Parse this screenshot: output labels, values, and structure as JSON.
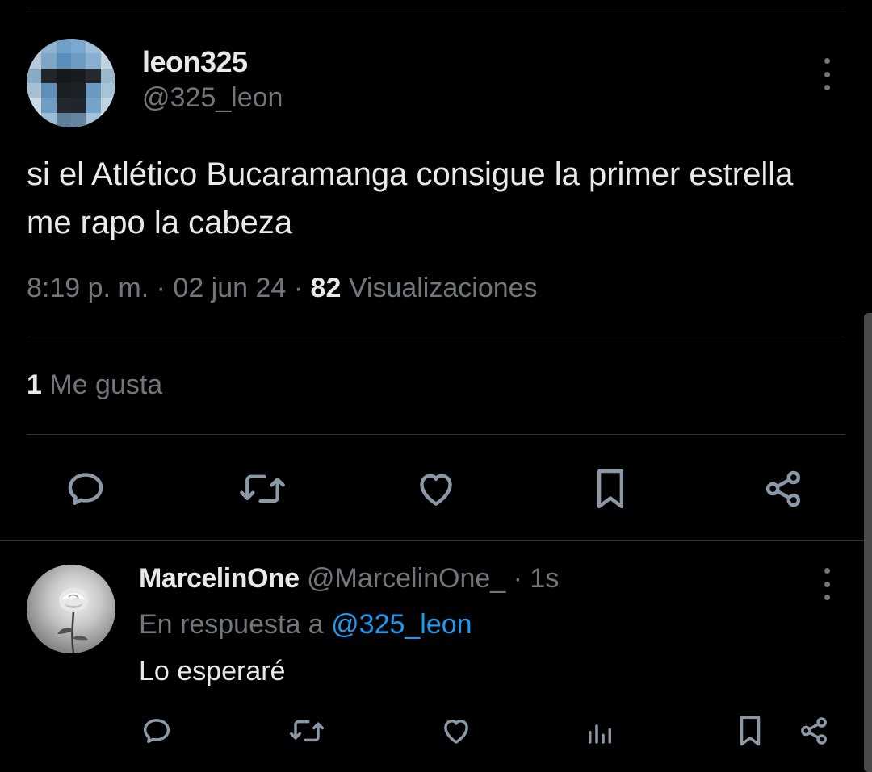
{
  "tweet": {
    "display_name": "leon325",
    "handle": "@325_leon",
    "text": "si el Atlético Bucaramanga consigue la primer estrella me rapo la cabeza",
    "time": "8:19 p. m.",
    "date": "02 jun 24",
    "separator": " · ",
    "views_count": "82",
    "views_label": " Visualizaciones",
    "likes_count": "1",
    "likes_label": " Me gusta",
    "actions": [
      "reply-icon",
      "retweet-icon",
      "like-icon",
      "bookmark-icon",
      "share-icon"
    ]
  },
  "reply": {
    "display_name": "MarcelinOne",
    "handle": "@MarcelinOne_",
    "time_sep": " · ",
    "time": "1s",
    "in_reply_prefix": "En respuesta a ",
    "in_reply_handle": "@325_leon",
    "text": "Lo esperaré",
    "actions": [
      "reply-icon",
      "retweet-icon",
      "like-icon",
      "analytics-icon",
      "bookmark-icon",
      "share-icon"
    ]
  },
  "colors": {
    "background": "#000000",
    "text_primary": "#e7e9ea",
    "text_secondary": "#71767b",
    "link": "#1d9bf0",
    "divider": "#2f3336"
  }
}
